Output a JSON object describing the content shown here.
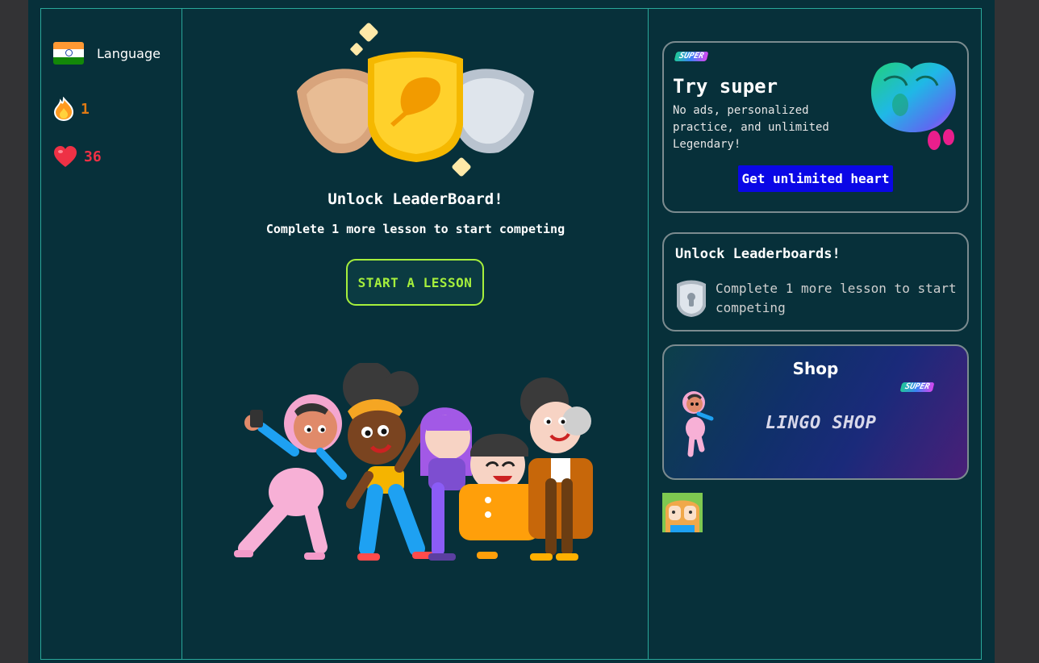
{
  "sidebar": {
    "language_label": "Language",
    "streak_count": "1",
    "hearts_count": "36",
    "icons": {
      "flag": "india-flag-icon",
      "streak": "fire-icon",
      "hearts": "heart-icon"
    }
  },
  "main": {
    "title": "Unlock LeaderBoard!",
    "subtitle": "Complete 1 more lesson to start competing",
    "start_button": "START A LESSON"
  },
  "right": {
    "super_card": {
      "badge": "SUPER",
      "title": "Try super",
      "description": "No ads, personalized practice, and unlimited Legendary!",
      "button": "Get unlimited heart"
    },
    "leaderboard_card": {
      "title": "Unlock Leaderboards!",
      "description": "Complete 1 more lesson to start competing"
    },
    "shop_card": {
      "title": "Shop",
      "badge": "SUPER",
      "name": "LINGO SHOP"
    }
  },
  "colors": {
    "background": "#07303a",
    "frame": "#2aa79a",
    "accent_green": "#a6ef3c",
    "streak": "#e07a14",
    "hearts": "#ee3145",
    "cta_blue": "#0a07e6"
  }
}
